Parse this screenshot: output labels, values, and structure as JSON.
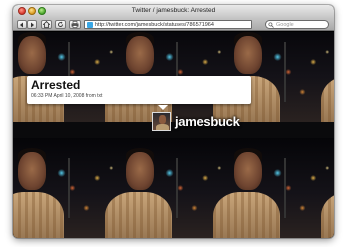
{
  "window": {
    "title": "Twitter / jamesbuck: Arrested"
  },
  "toolbar": {
    "back_icon": "back-arrow-icon",
    "forward_icon": "forward-arrow-icon",
    "home_icon": "home-icon",
    "reload_icon": "reload-icon",
    "print_icon": "print-icon",
    "url": "http://twitter.com/jamesbuck/statuses/786571964",
    "search_placeholder": "Google"
  },
  "tweet": {
    "text": "Arrested",
    "meta": "06:33 PM April 10, 2008 from txt",
    "username": "jamesbuck"
  },
  "colors": {
    "background": "#0a0a0c",
    "tweet_box": "#ffffff",
    "username_text": "#ffffff",
    "chrome": "#b9b9b9"
  }
}
